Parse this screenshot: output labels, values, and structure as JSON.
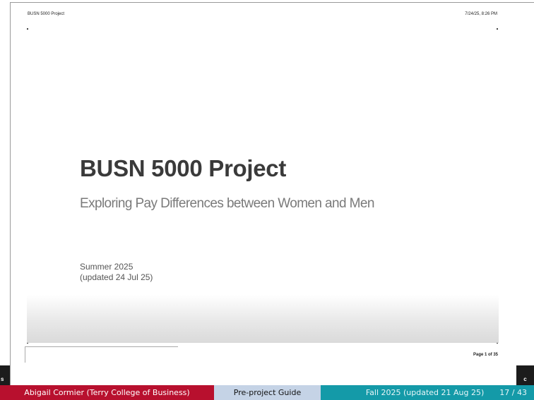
{
  "print_header": {
    "left": "BUSN 5000 Project",
    "right": "7/24/25, 8:26 PM"
  },
  "slide": {
    "title": "BUSN 5000 Project",
    "subtitle": "Exploring Pay Differences between Women and Men",
    "term": "Summer 2025",
    "updated": "(updated 24 Jul 25)"
  },
  "print_footer": {
    "page": "Page 1 of 35"
  },
  "side_buttons": {
    "left": "s",
    "right": "c"
  },
  "footline": {
    "author": "Abigail Cormier  (Terry College of Business)",
    "title": "Pre-project Guide",
    "date": "Fall 2025 (updated 21 Aug 25)",
    "frame": "17 / 43"
  },
  "colors": {
    "author_bg": "#b8102e",
    "title_bg": "#c5d3e6",
    "date_bg": "#149aa8"
  }
}
